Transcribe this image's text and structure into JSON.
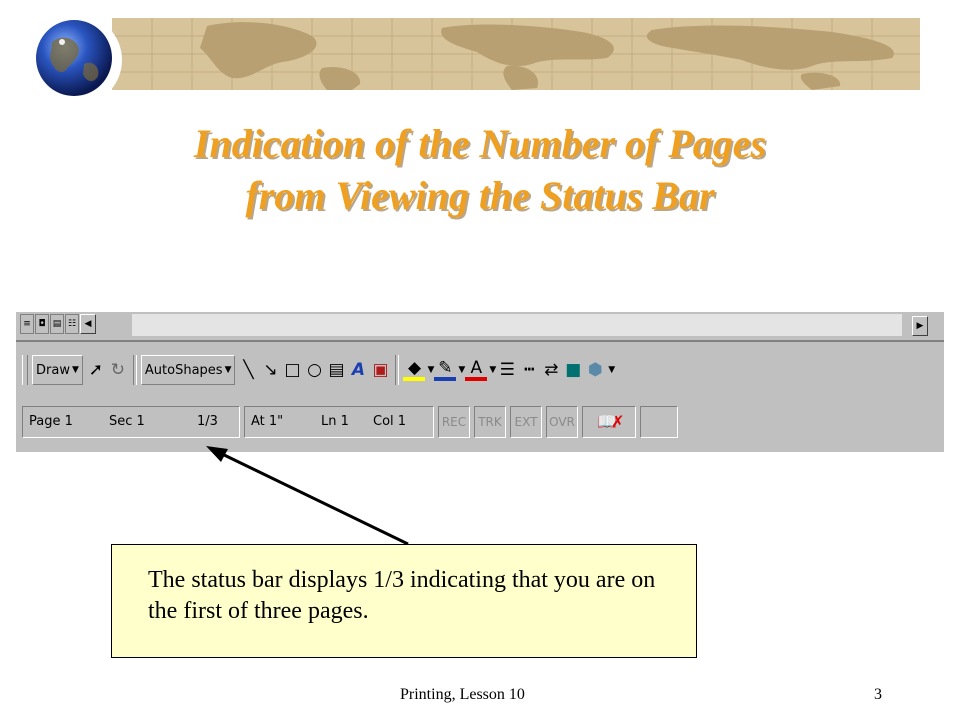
{
  "title": {
    "line1": "Indication of the Number of Pages",
    "line2": "from Viewing the Status Bar"
  },
  "colors": {
    "title": "#f0a020",
    "banner": "#d8c49a",
    "callout_bg": "#ffffcc",
    "toolbar_bg": "#c0c0c0"
  },
  "drawing_toolbar": {
    "draw_label": "Draw",
    "autoshapes_label": "AutoShapes",
    "icons": [
      "pointer-icon",
      "rotate-icon",
      "line-icon",
      "arrow-icon",
      "rectangle-icon",
      "oval-icon",
      "textbox-icon",
      "wordart-icon",
      "clipart-icon",
      "fill-color-icon",
      "line-color-icon",
      "font-color-icon",
      "line-style-icon",
      "dash-style-icon",
      "arrow-style-icon",
      "shadow-icon",
      "3d-icon"
    ],
    "font_color_glyph": "A"
  },
  "status_bar": {
    "page": "Page 1",
    "section": "Sec 1",
    "page_count": "1/3",
    "at": "At 1\"",
    "line": "Ln 1",
    "col": "Col 1",
    "rec": "REC",
    "trk": "TRK",
    "ext": "EXT",
    "ovr": "OVR"
  },
  "callout": {
    "text": "The status bar displays 1/3 indicating that you are on the first of three pages."
  },
  "footer": {
    "lesson": "Printing, Lesson 10",
    "slide_number": "3"
  }
}
